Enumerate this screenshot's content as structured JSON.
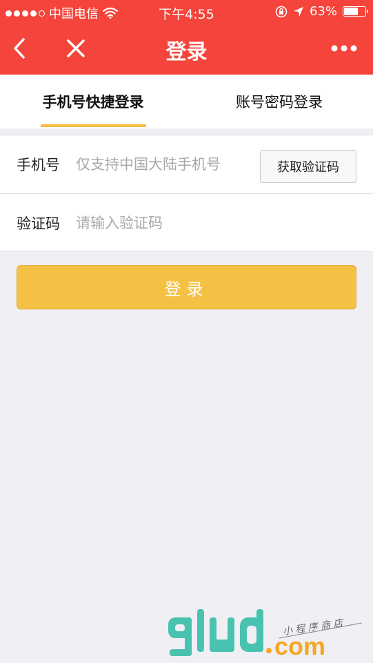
{
  "status_bar": {
    "carrier": "中国电信",
    "time": "下午4:55",
    "battery_text": "63%",
    "battery_level": 0.63
  },
  "nav": {
    "title": "登录",
    "back_icon": "back-chevron-icon",
    "close_icon": "close-icon",
    "more_icon": "more-dots-icon"
  },
  "tabs": [
    {
      "label": "手机号快捷登录",
      "active": true
    },
    {
      "label": "账号密码登录",
      "active": false
    }
  ],
  "form": {
    "phone_label": "手机号",
    "phone_placeholder": "仅支持中国大陆手机号",
    "phone_value": "",
    "get_code_label": "获取验证码",
    "code_label": "验证码",
    "code_placeholder": "请输入验证码",
    "code_value": ""
  },
  "login_button": "登录",
  "watermark": {
    "brand": "glud.com",
    "tagline": "小程序商店"
  },
  "colors": {
    "primary_red": "#f4443b",
    "accent_yellow": "#f5c144",
    "watermark_teal": "#4ac2b0",
    "watermark_orange": "#f5a623"
  }
}
